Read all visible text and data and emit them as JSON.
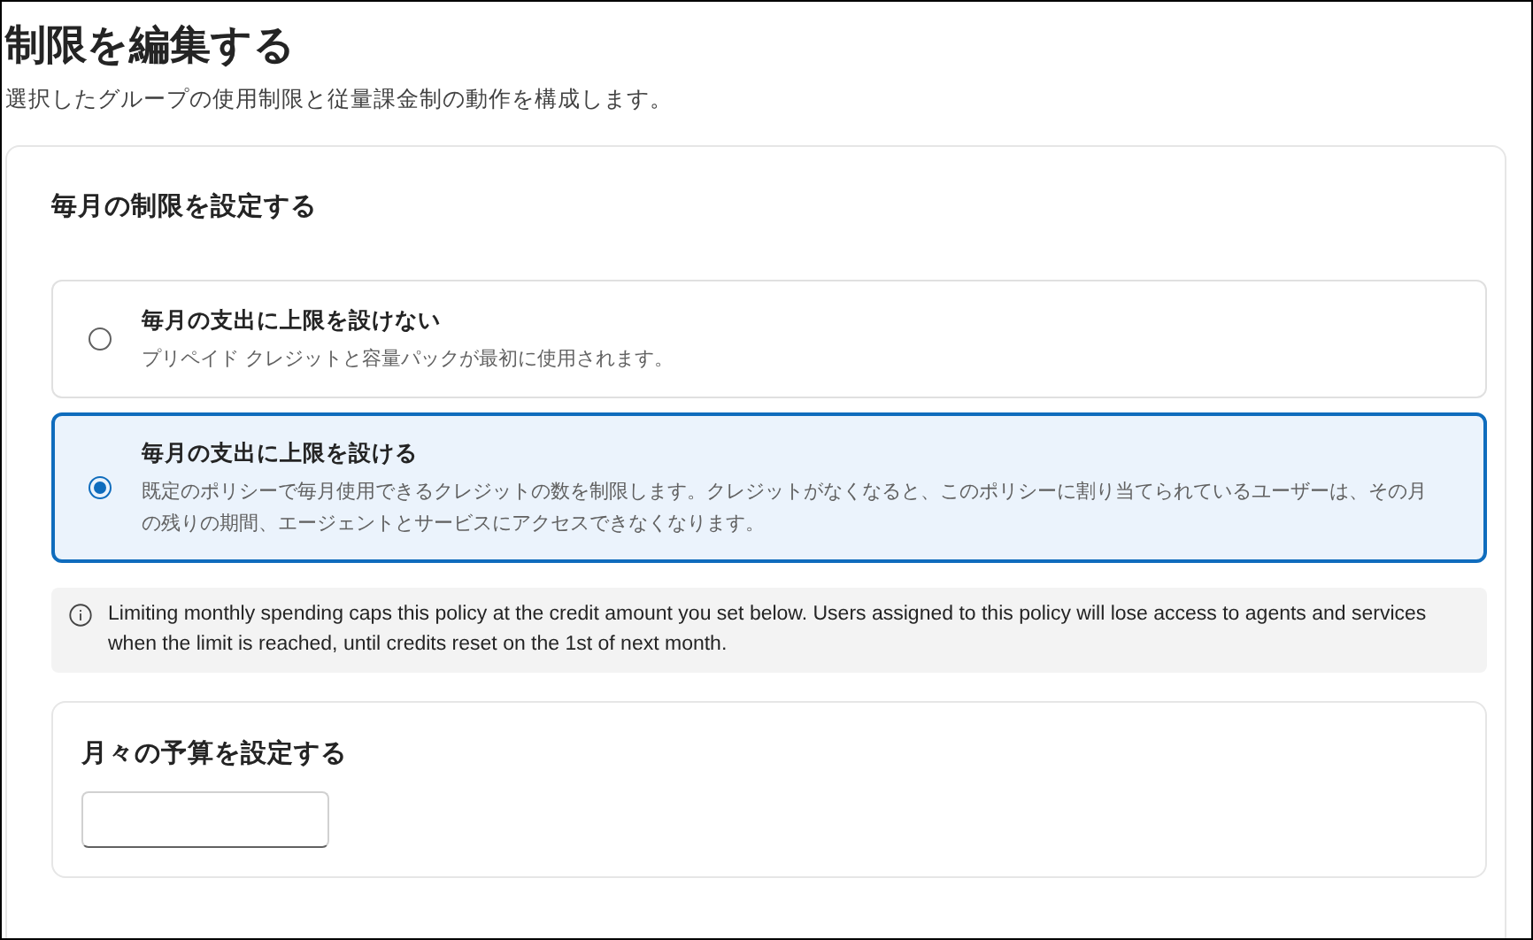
{
  "page": {
    "title": "制限を編集する",
    "subtitle": "選択したグループの使用制限と従量課金制の動作を構成します。"
  },
  "monthly_limit": {
    "heading": "毎月の制限を設定する",
    "options": [
      {
        "title": "毎月の支出に上限を設けない",
        "description": "プリペイド クレジットと容量パックが最初に使用されます。",
        "selected": false
      },
      {
        "title": "毎月の支出に上限を設ける",
        "description": "既定のポリシーで毎月使用できるクレジットの数を制限します。クレジットがなくなると、このポリシーに割り当てられているユーザーは、その月の残りの期間、エージェントとサービスにアクセスできなくなります。",
        "selected": true
      }
    ],
    "info": "Limiting monthly spending caps this policy at the credit amount you set below. Users assigned to this policy will lose access to agents and services when the limit is reached, until credits reset on the 1st of next month.",
    "budget": {
      "heading": "月々の予算を設定する"
    }
  }
}
